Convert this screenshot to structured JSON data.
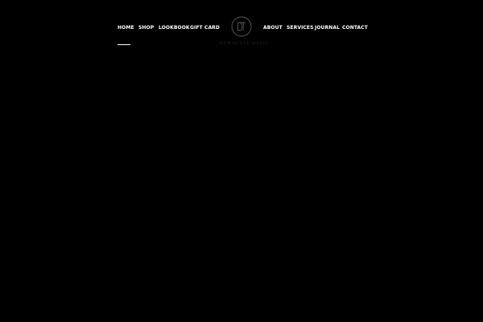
{
  "nav": {
    "left": [
      {
        "label": "HOME"
      },
      {
        "label": "SHOP"
      },
      {
        "label": "LOOKBOOK"
      },
      {
        "label": "GIFT CARD"
      }
    ],
    "right": [
      {
        "label": "ABOUT"
      },
      {
        "label": "SERVICES"
      },
      {
        "label": "JOURNAL"
      },
      {
        "label": "CONTACT"
      }
    ],
    "active": "HOME"
  },
  "logo": {
    "monogram": "DT",
    "subtitle": "DOMINIQUE DAVIS"
  },
  "colors": {
    "background": "#000000",
    "nav_text": "#ffffff",
    "logo_line": "#5a5a5a"
  },
  "icons": {
    "logo": "circle-monogram-logo"
  }
}
